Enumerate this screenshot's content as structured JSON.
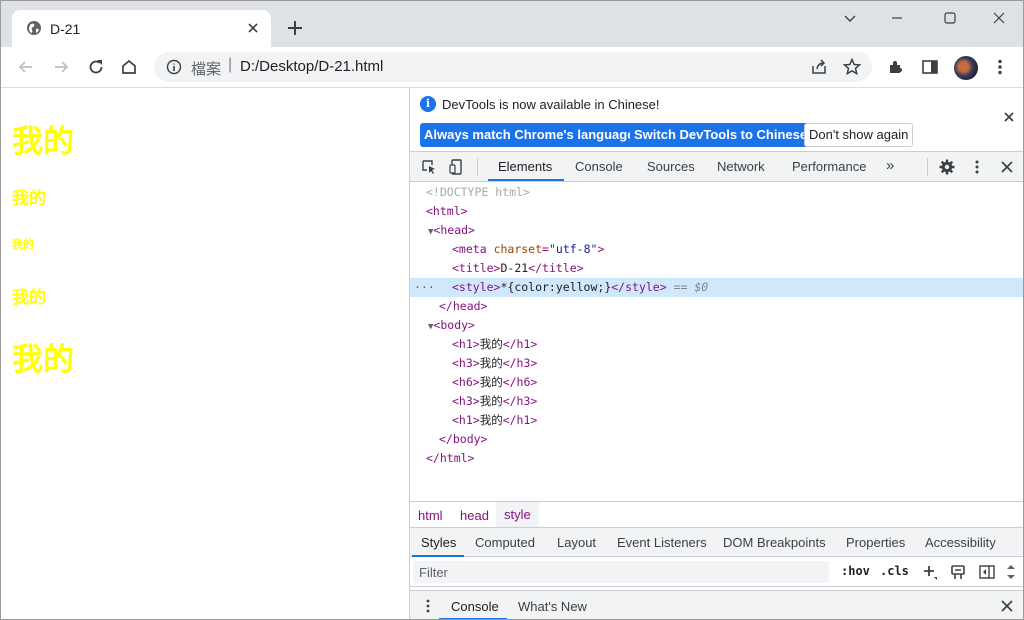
{
  "browser": {
    "tab_title": "D-21",
    "url_scheme_label": "檔案",
    "url_separator": "|",
    "url": "D:/Desktop/D-21.html"
  },
  "page": {
    "color": "#ffff00",
    "headings": [
      {
        "tag": "h1",
        "text": "我的"
      },
      {
        "tag": "h3",
        "text": "我的"
      },
      {
        "tag": "h6",
        "text": "我的"
      },
      {
        "tag": "h3",
        "text": "我的"
      },
      {
        "tag": "h1",
        "text": "我的"
      }
    ]
  },
  "devtools": {
    "infobar": {
      "message": "DevTools is now available in Chinese!",
      "btn_match": "Always match Chrome's language",
      "btn_switch": "Switch DevTools to Chinese",
      "btn_dismiss": "Don't show again"
    },
    "tabs": [
      "Elements",
      "Console",
      "Sources",
      "Network",
      "Performance"
    ],
    "more_tabs": "»",
    "dom": {
      "doctype": "<!DOCTYPE html>",
      "html_open": "<html>",
      "head_open": "<head>",
      "meta_tag_open": "<meta",
      "meta_attr": "charset",
      "meta_eq": "=",
      "meta_val": "\"utf-8\"",
      "meta_close": ">",
      "title_open": "<title>",
      "title_text": "D-21",
      "title_close": "</title>",
      "style_open": "<style>",
      "style_text": "*{color:yellow;}",
      "style_close": "</style>",
      "style_ref": "== $0",
      "ellipsis": "···",
      "head_close": "</head>",
      "body_open": "<body>",
      "body_children": [
        {
          "open": "<h1>",
          "text": "我的",
          "close": "</h1>"
        },
        {
          "open": "<h3>",
          "text": "我的",
          "close": "</h3>"
        },
        {
          "open": "<h6>",
          "text": "我的",
          "close": "</h6>"
        },
        {
          "open": "<h3>",
          "text": "我的",
          "close": "</h3>"
        },
        {
          "open": "<h1>",
          "text": "我的",
          "close": "</h1>"
        }
      ],
      "body_close": "</body>",
      "html_close": "</html>"
    },
    "breadcrumbs": [
      "html",
      "head",
      "style"
    ],
    "subtabs": [
      "Styles",
      "Computed",
      "Layout",
      "Event Listeners",
      "DOM Breakpoints",
      "Properties",
      "Accessibility"
    ],
    "filter": {
      "placeholder": "Filter",
      "hov": ":hov",
      "cls": ".cls"
    },
    "drawer": {
      "tabs": [
        "Console",
        "What's New"
      ]
    }
  },
  "colors": {
    "accent": "#1a73e8",
    "tag": "#881280",
    "selection": "#cfe8fc"
  }
}
